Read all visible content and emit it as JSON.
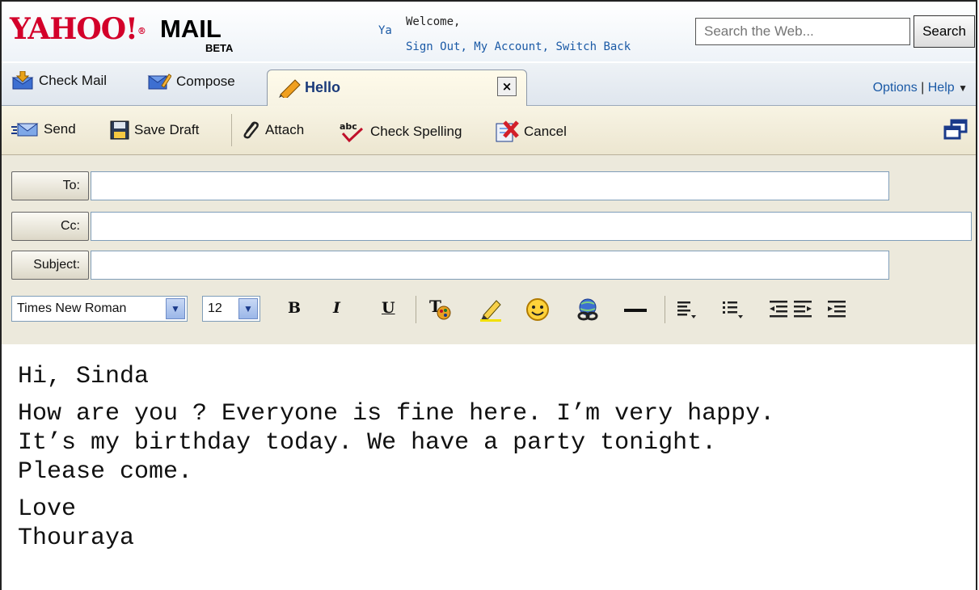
{
  "header": {
    "logo": "YAHOO!",
    "logo_mark": "®",
    "product": "MAIL",
    "badge": "BETA",
    "user_abbrev": "Ya",
    "welcome": "Welcome,",
    "sign_out": "Sign Out",
    "my_account": "My Account",
    "switch_back": "Switch Back",
    "search_placeholder": "Search the Web...",
    "search_button": "Search"
  },
  "tabs": {
    "check_mail": "Check Mail",
    "compose": "Compose",
    "active_tab": "Hello",
    "close": "×",
    "options": "Options",
    "help": "Help"
  },
  "actions": {
    "send": "Send",
    "save_draft": "Save Draft",
    "attach": "Attach",
    "check_spelling": "Check Spelling",
    "cancel": "Cancel"
  },
  "fields": {
    "to_label": "To:",
    "cc_label": "Cc:",
    "subject_label": "Subject:",
    "to_value": "",
    "cc_value": "",
    "subject_value": ""
  },
  "format": {
    "font": "Times New Roman",
    "size": "12",
    "bold": "B",
    "italic": "I",
    "underline": "U"
  },
  "message": {
    "greeting": "Hi, Sinda",
    "line1": "How are you ? Everyone is fine here. I’m very happy.",
    "line2": "It’s my birthday today. We have a party tonight.",
    "line3": "Please come.",
    "closing": "Love",
    "signature": "Thouraya"
  },
  "colors": {
    "brand_red": "#d3002a",
    "link_blue": "#1b5aa6",
    "toolbar_bg": "#ece6d0"
  }
}
